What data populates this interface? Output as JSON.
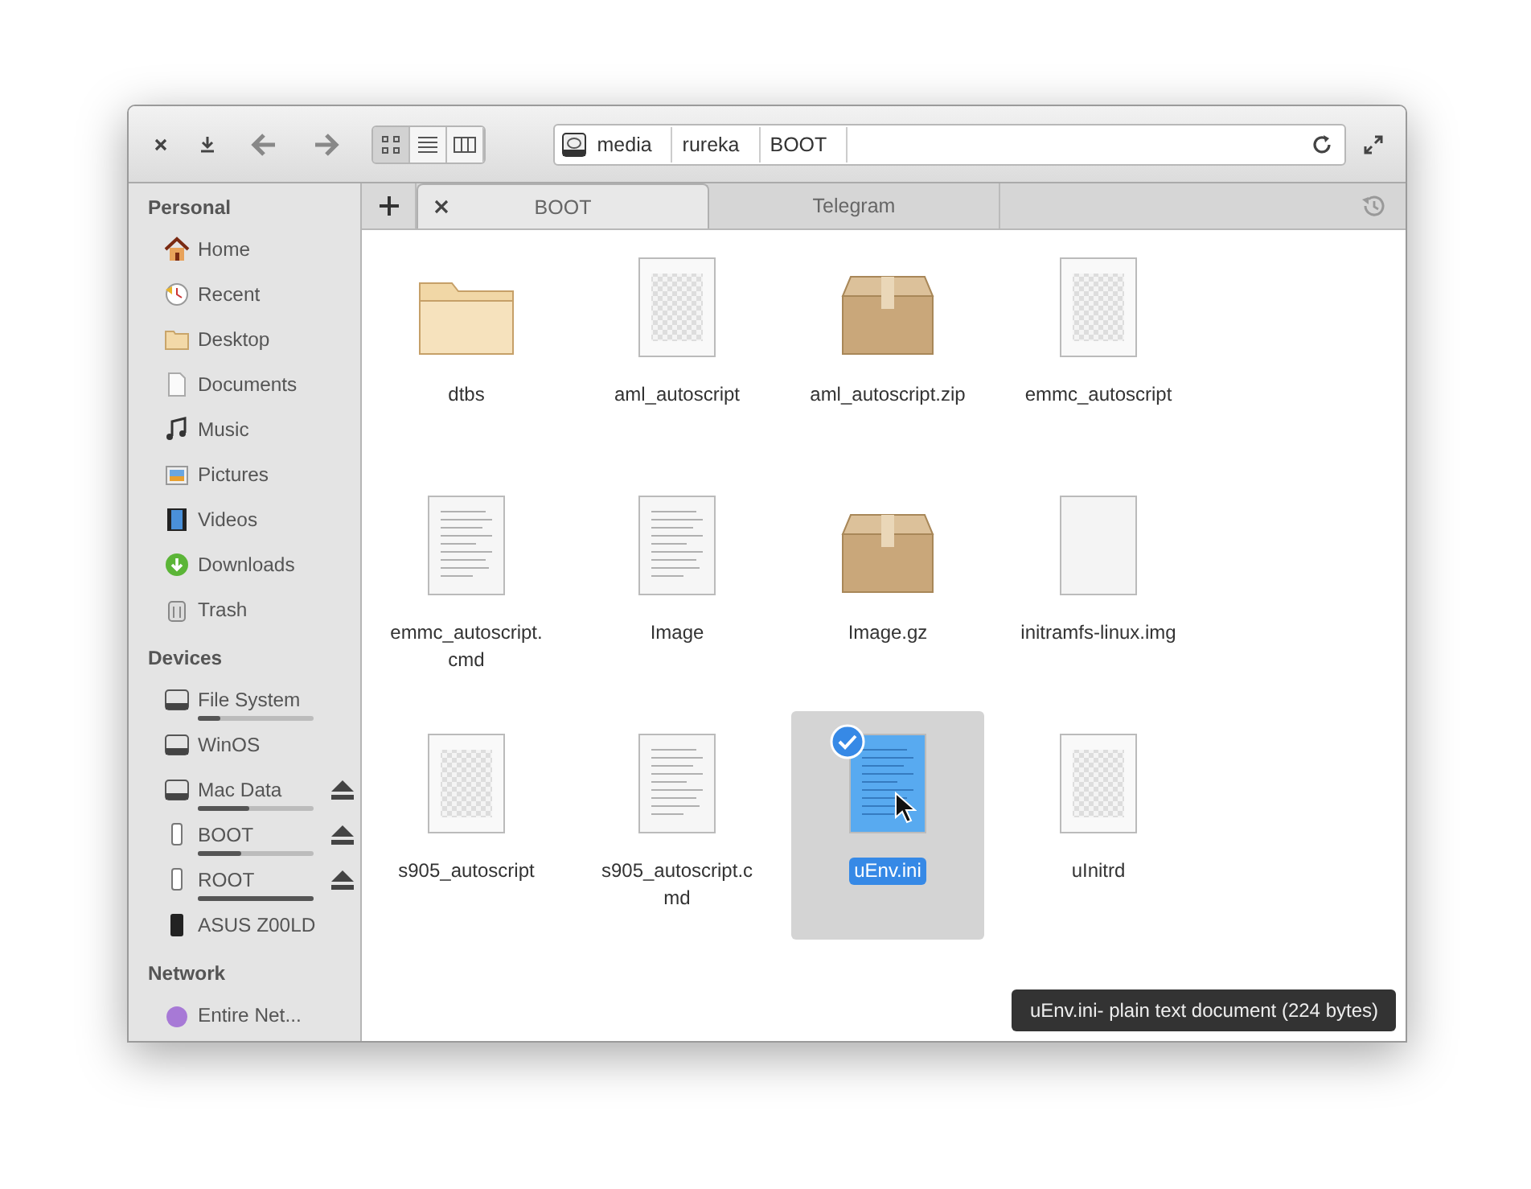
{
  "toolbar": {
    "views": [
      {
        "kind": "grid",
        "selected": true
      },
      {
        "kind": "list",
        "selected": false
      },
      {
        "kind": "columns",
        "selected": false
      }
    ],
    "path": [
      "media",
      "rureka",
      "BOOT"
    ]
  },
  "tabs": [
    {
      "label": "BOOT",
      "selected": true
    },
    {
      "label": "Telegram",
      "selected": false
    }
  ],
  "sidebar": [
    {
      "heading": "Personal",
      "items": [
        {
          "label": "Home",
          "kind": "home"
        },
        {
          "label": "Recent",
          "kind": "recent"
        },
        {
          "label": "Desktop",
          "kind": "folder"
        },
        {
          "label": "Documents",
          "kind": "doc"
        },
        {
          "label": "Music",
          "kind": "music"
        },
        {
          "label": "Pictures",
          "kind": "pictures"
        },
        {
          "label": "Videos",
          "kind": "videos"
        },
        {
          "label": "Downloads",
          "kind": "downloads"
        },
        {
          "label": "Trash",
          "kind": "trash"
        }
      ]
    },
    {
      "heading": "Devices",
      "items": [
        {
          "label": "File System",
          "kind": "disk",
          "level": 0.2
        },
        {
          "label": "WinOS",
          "kind": "disk"
        },
        {
          "label": "Mac Data",
          "kind": "disk",
          "level": 0.45,
          "eject": true
        },
        {
          "label": "BOOT",
          "kind": "usb",
          "level": 0.38,
          "eject": true
        },
        {
          "label": "ROOT",
          "kind": "usb",
          "level": 1.0,
          "eject": true
        },
        {
          "label": "ASUS Z00LD",
          "kind": "phone"
        }
      ]
    },
    {
      "heading": "Network",
      "items": [
        {
          "label": "Entire Net...",
          "kind": "network"
        }
      ]
    }
  ],
  "files": [
    {
      "name": "dtbs",
      "kind": "folder",
      "selected": false
    },
    {
      "name": "aml_autoscript",
      "kind": "binary",
      "selected": false
    },
    {
      "name": "aml_autoscript.zip",
      "kind": "package",
      "selected": false
    },
    {
      "name": "emmc_autoscript",
      "kind": "binary",
      "selected": false
    },
    {
      "name": "emmc_autoscript.cmd",
      "kind": "text",
      "selected": false
    },
    {
      "name": "Image",
      "kind": "text",
      "selected": false
    },
    {
      "name": "Image.gz",
      "kind": "package",
      "selected": false
    },
    {
      "name": "initramfs-linux.img",
      "kind": "blank",
      "selected": false
    },
    {
      "name": "s905_autoscript",
      "kind": "binary",
      "selected": false
    },
    {
      "name": "s905_autoscript.cmd",
      "kind": "text",
      "selected": false
    },
    {
      "name": "uEnv.ini",
      "kind": "text",
      "selected": true
    },
    {
      "name": "uInitrd",
      "kind": "binary",
      "selected": false
    }
  ],
  "tooltip": "uEnv.ini- plain text document (224 bytes)"
}
